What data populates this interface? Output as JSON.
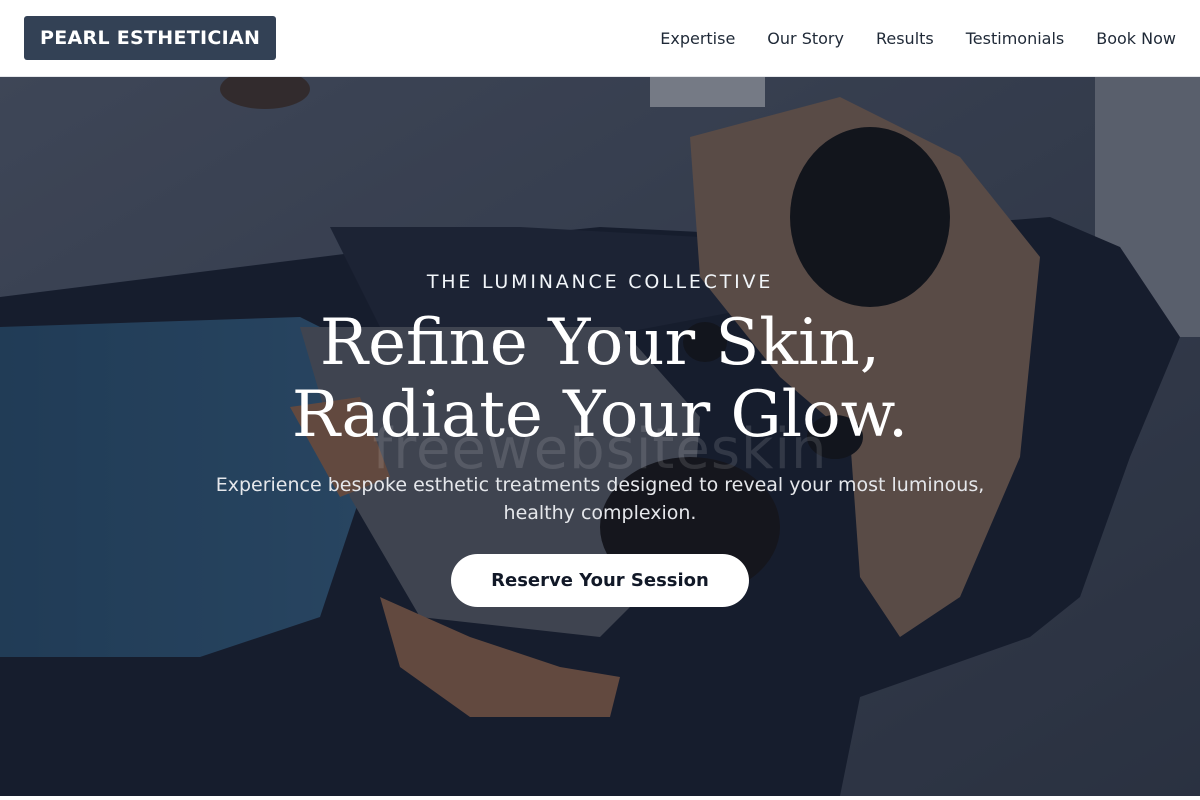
{
  "header": {
    "logo": "PEARL ESTHETICIAN",
    "nav": [
      {
        "label": "Expertise"
      },
      {
        "label": "Our Story"
      },
      {
        "label": "Results"
      },
      {
        "label": "Testimonials"
      },
      {
        "label": "Book Now"
      }
    ]
  },
  "hero": {
    "eyebrow": "THE LUMINANCE COLLECTIVE",
    "headline": "Refine Your Skin, Radiate Your Glow.",
    "subtext": "Experience bespoke esthetic treatments designed to reveal your most luminous, healthy complexion.",
    "cta_label": "Reserve Your Session",
    "watermark": "freewebsiteskin"
  },
  "colors": {
    "logo_bg": "#334155",
    "nav_text": "#1f2937",
    "cta_bg": "#ffffff",
    "cta_text": "#111827"
  }
}
